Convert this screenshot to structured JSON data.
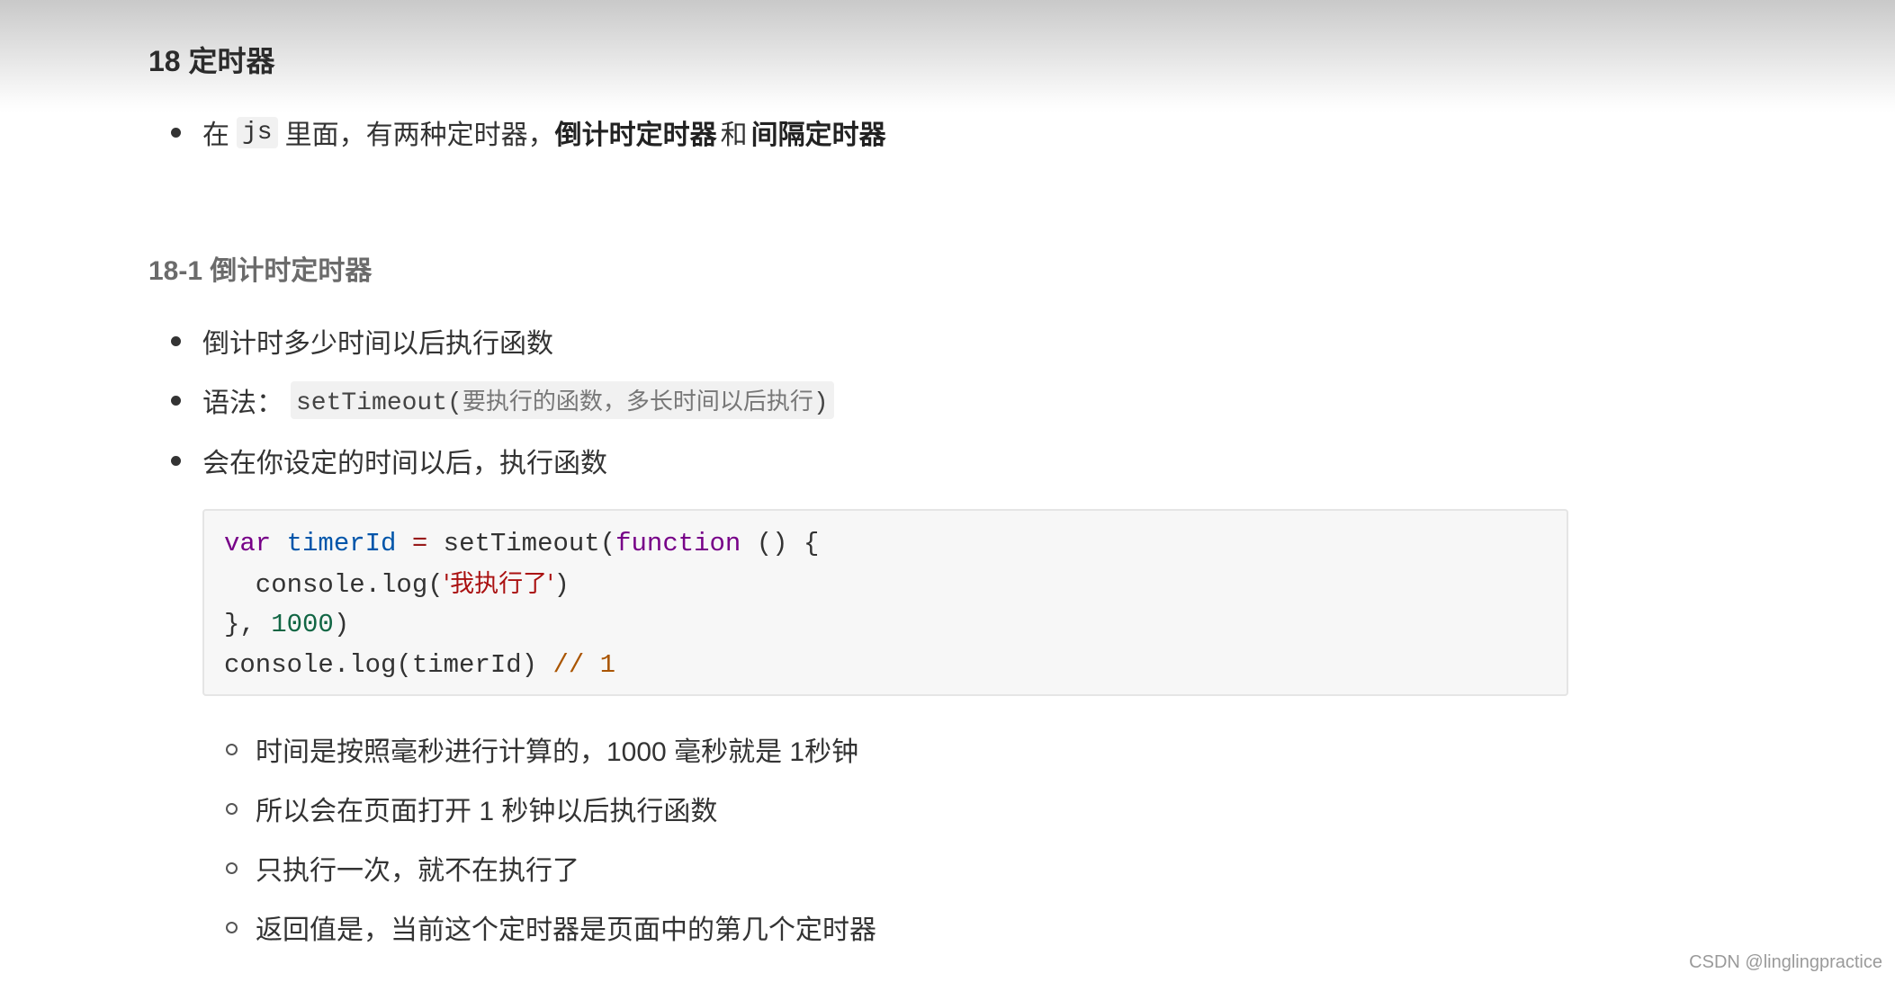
{
  "section": {
    "title": "18 定时器",
    "intro": {
      "pre": "在",
      "code": "js",
      "mid": "里面，有两种定时器，",
      "bold1": "倒计时定时器",
      "and": "和",
      "bold2": "间隔定时器"
    }
  },
  "subsection": {
    "title": "18-1 倒计时定时器",
    "bullets": {
      "b1": "倒计时多少时间以后执行函数",
      "b2_label": "语法：",
      "b2_code_fn": "setTimeout(",
      "b2_code_args": "要执行的函数，多长时间以后执行",
      "b2_code_close": ")",
      "b3": "会在你设定的时间以后，执行函数"
    },
    "code": {
      "l1_kw": "var",
      "l1_var": "timerId",
      "l1_op": "=",
      "l1_fn": "setTimeout(",
      "l1_kw2": "function",
      "l1_rest": "() {",
      "l2_pre": "  console.log(",
      "l2_str": "'我执行了'",
      "l2_post": ")",
      "l3_pre": "}, ",
      "l3_num": "1000",
      "l3_post": ")",
      "l4_pre": "console.log(timerId) ",
      "l4_cmt": "// 1"
    },
    "notes": [
      "时间是按照毫秒进行计算的，1000 毫秒就是 1秒钟",
      "所以会在页面打开 1 秒钟以后执行函数",
      "只执行一次，就不在执行了",
      "返回值是，当前这个定时器是页面中的第几个定时器"
    ]
  },
  "watermark": "CSDN @linglingpractice"
}
